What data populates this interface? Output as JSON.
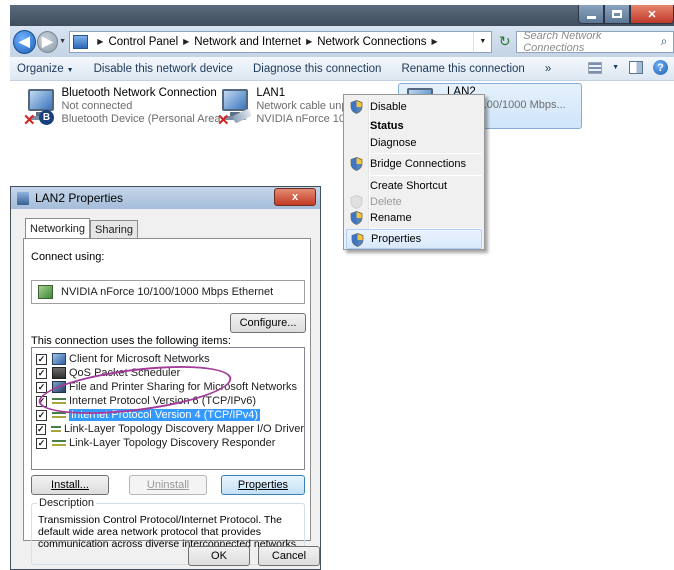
{
  "explorer": {
    "breadcrumbs": [
      "Control Panel",
      "Network and Internet",
      "Network Connections"
    ],
    "search_placeholder": "Search Network Connections",
    "toolbar": {
      "organize": "Organize",
      "disable": "Disable this network device",
      "diagnose": "Diagnose this connection",
      "rename": "Rename this connection",
      "more": "»"
    },
    "connections": [
      {
        "name": "Bluetooth Network Connection",
        "status": "Not connected",
        "device": "Bluetooth Device (Personal Area ..."
      },
      {
        "name": "LAN1",
        "status": "Network cable unplugg",
        "device": "NVIDIA nForce 10/100/"
      },
      {
        "name": "LAN2",
        "status": "",
        "device": "rce 10/100/1000 Mbps..."
      }
    ]
  },
  "context_menu": {
    "items": [
      "Disable",
      "Status",
      "Diagnose",
      "Bridge Connections",
      "Create Shortcut",
      "Delete",
      "Rename",
      "Properties"
    ]
  },
  "dialog": {
    "title": "LAN2 Properties",
    "close_label": "x",
    "tabs": [
      "Networking",
      "Sharing"
    ],
    "connect_using_label": "Connect using:",
    "adapter": "NVIDIA nForce 10/100/1000 Mbps Ethernet",
    "configure_label": "Configure...",
    "items_label": "This connection uses the following items:",
    "items": [
      {
        "label": "Client for Microsoft Networks",
        "checked": true
      },
      {
        "label": "QoS Packet Scheduler",
        "checked": true
      },
      {
        "label": "File and Printer Sharing for Microsoft Networks",
        "checked": true
      },
      {
        "label": "Internet Protocol Version 6 (TCP/IPv6)",
        "checked": true
      },
      {
        "label": "Internet Protocol Version 4 (TCP/IPv4)",
        "checked": true
      },
      {
        "label": "Link-Layer Topology Discovery Mapper I/O Driver",
        "checked": true
      },
      {
        "label": "Link-Layer Topology Discovery Responder",
        "checked": true
      }
    ],
    "install_label": "Install...",
    "uninstall_label": "Uninstall",
    "properties_label": "Properties",
    "description_label": "Description",
    "description": "Transmission Control Protocol/Internet Protocol. The default wide area network protocol that provides communication across diverse interconnected networks.",
    "ok_label": "OK",
    "cancel_label": "Cancel"
  },
  "colors": {
    "annotation": "#a43c9c",
    "selection": "#3399ff"
  }
}
